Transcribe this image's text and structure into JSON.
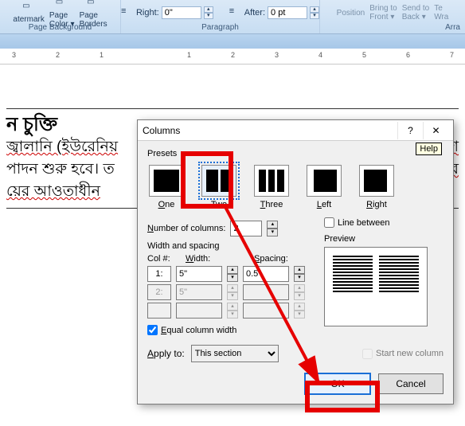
{
  "ribbon": {
    "page_bg": {
      "watermark": "atermark",
      "page_color": "Page\nColor ▾",
      "page_borders": "Page\nBorders",
      "label": "Page Background"
    },
    "paragraph": {
      "right_lbl": "Right:",
      "right_val": "0\"",
      "after_lbl": "After:",
      "after_val": "0 pt",
      "label": "Paragraph"
    },
    "arrange": {
      "position": "Position",
      "bring_front": "Bring to\nFront ▾",
      "send_back": "Send to\nBack ▾",
      "wrap": "Te\nWra",
      "label": "Arra"
    }
  },
  "ruler": {
    "nums": [
      "3",
      "2",
      "1",
      "1",
      "2",
      "3",
      "4",
      "5",
      "6",
      "7"
    ]
  },
  "document": {
    "l1": "ন চুক্তি",
    "l2": "জ্বালানি (ইউরেনিয়",
    "l3": "পাদন শুরু হবে। ত",
    "l4": "য়ের আওতাধীন",
    "r2": "াংলাদেশ",
    "r3": "মাসার ব"
  },
  "dialog": {
    "title": "Columns",
    "help": "?",
    "help_tip": "Help",
    "close": "✕",
    "presets_lbl": "Presets",
    "presets": [
      {
        "key": "one",
        "label": "One",
        "u": "O"
      },
      {
        "key": "two",
        "label": "Two",
        "u": "w"
      },
      {
        "key": "three",
        "label": "Three",
        "u": "T"
      },
      {
        "key": "left",
        "label": "Left",
        "u": "L"
      },
      {
        "key": "right",
        "label": "Right",
        "u": "R"
      }
    ],
    "numcols_lbl": "Number of columns:",
    "numcols_val": "2",
    "line_between": "Line between",
    "ws_lbl": "Width and spacing",
    "preview_lbl": "Preview",
    "col_hdr": "Col #:",
    "width_hdr": "Width:",
    "spacing_hdr": "Spacing:",
    "rows": [
      {
        "n": "1:",
        "w": "5\"",
        "s": "0.5\"",
        "en": true
      },
      {
        "n": "2:",
        "w": "5\"",
        "s": "",
        "en": false
      },
      {
        "n": "",
        "w": "",
        "s": "",
        "en": false
      }
    ],
    "equal": "Equal column width",
    "apply_lbl": "Apply to:",
    "apply_val": "This section",
    "start_new": "Start new column",
    "ok": "OK",
    "cancel": "Cancel"
  }
}
